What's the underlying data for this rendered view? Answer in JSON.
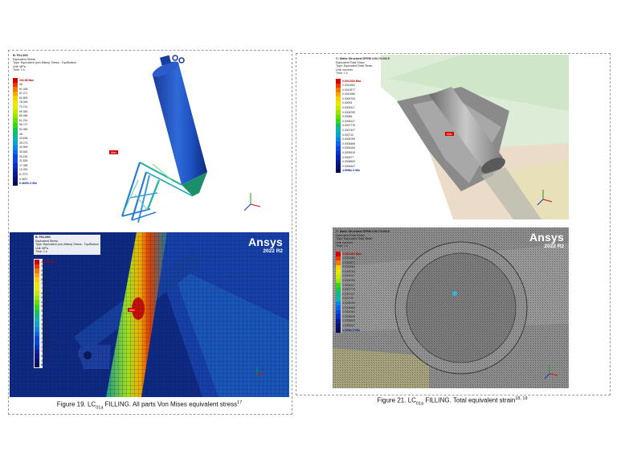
{
  "panels": {
    "top_left": {
      "header": [
        "B: FILLING",
        "Equivalent Stress",
        "Type: Equivalent (von-Mises) Stress - Top/Bottom",
        "Unit: MPa",
        "Time: 1 s"
      ],
      "legend": [
        "202.98 Max",
        "96",
        "91.406",
        "87.271",
        "82.809",
        "78.345",
        "73.741",
        "69.353",
        "65.455",
        "61.291",
        "56.727",
        "52.364",
        "48",
        "43.636",
        "39.273",
        "34.909",
        "30.545",
        "26.182",
        "21.818",
        "17.455",
        "13.091",
        "8.7273",
        "4.3637",
        "5.4625e-5 Min"
      ],
      "max_tag": "Max"
    },
    "bottom_left": {
      "header": [
        "B: FILLING",
        "Equivalent Stress",
        "Type: Equivalent (von-Mises) Stress - Top/Bottom",
        "Unit: MPa",
        "Time: 1 s"
      ],
      "legend": [
        "202.98 Max",
        "96",
        "91.406",
        "87.271",
        "82.909",
        "78.545",
        "74.182",
        "69.818",
        "65.455",
        "61.091",
        "56.727",
        "52.364",
        "48",
        "43.636",
        "39.273",
        "34.909",
        "30.545",
        "26.182",
        "21.818",
        "17.455",
        "13.091",
        "8.7273",
        "4.3637",
        "5.4625e-5 Min"
      ],
      "max_tag": "Max",
      "brand_name": "Ansys",
      "brand_version": "2022 R2"
    },
    "top_right": {
      "header": [
        "C: Static Structural DFEM 4.94.7/4.9/4.5",
        "Equivalent Total Strain",
        "Type: Equivalent Total Strain",
        "Unit: mm/mm",
        "Time: 1 s"
      ],
      "legend": [
        "0.0011384 Max",
        "0.0011084",
        "0.0010577",
        "0.0010066",
        "0.0009753",
        "0.00093",
        "0.0009117",
        "0.0008799",
        "0.00084",
        "0.0008127",
        "0.0007775",
        "0.0007427",
        "0.000712",
        "0.0006759",
        "0.0006465",
        "0.0006184",
        "0.0005919",
        "0.000577",
        "0.0005609",
        "0.0005447",
        "4.5996e-5 Min"
      ],
      "max_tag": "Max"
    },
    "bottom_right": {
      "header": [
        "C: Static Structural DFEM 4.94.7/4.9/4.5",
        "Equivalent Total Strain",
        "Type: Equivalent Total Strain",
        "Unit: mm/mm",
        "Time: 1 s"
      ],
      "legend": [
        "0.0011384 Max",
        "0.0011084",
        "0.0010577",
        "0.0010066",
        "0.0009753",
        "0.0009117",
        "0.0008799",
        "0.0008127",
        "0.0007775",
        "0.0007427",
        "0.000712",
        "0.0006759",
        "0.0006465",
        "0.0006184",
        "0.0005919",
        "0.0005609",
        "0.0005447",
        "4.5996e-5 Min"
      ],
      "brand_name": "Ansys",
      "brand_version": "2022 R2"
    }
  },
  "captions": {
    "left": {
      "prefix": "Figure 19. LC",
      "sub": "01a",
      "main": " FILLING. All parts Von Mises equivalent stress",
      "sup": "17"
    },
    "right": {
      "prefix": "Figure 21. LC",
      "sub": "01a",
      "main": " FILLING. Total equivalent strain",
      "sup": "18, 19"
    }
  },
  "colors": {
    "legend_scale": [
      "#d20000",
      "#e83a00",
      "#f07a00",
      "#f5a800",
      "#f6d000",
      "#e8e800",
      "#c4e800",
      "#96e600",
      "#66e000",
      "#36d61a",
      "#17c64e",
      "#12b884",
      "#12b2b0",
      "#10a0d0",
      "#0e86e0",
      "#0c66e6",
      "#0a48dc",
      "#0a30c8",
      "#0a22a8",
      "#081a8c",
      "#061270",
      "#040d58"
    ]
  }
}
